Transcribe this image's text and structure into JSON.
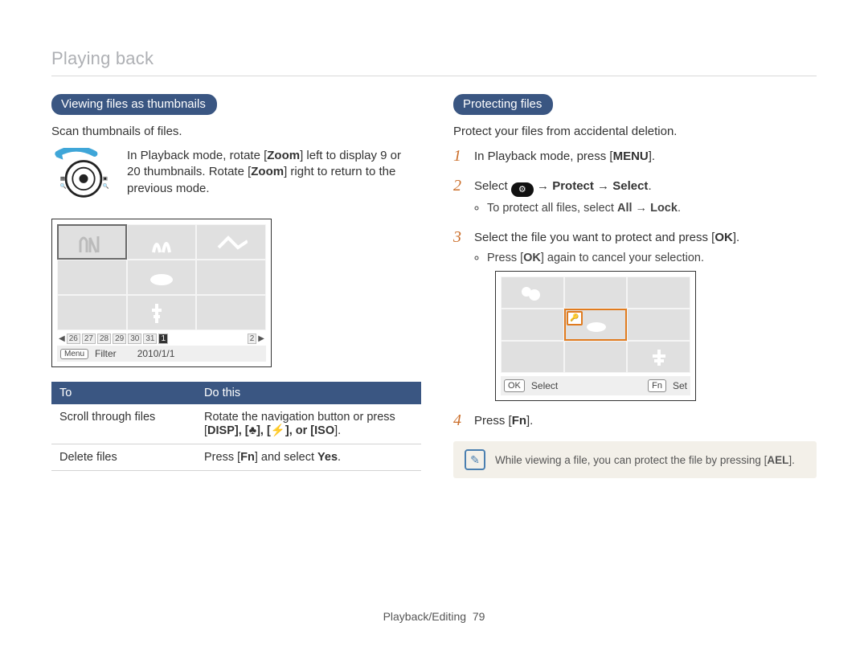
{
  "header": {
    "title": "Playing back"
  },
  "left": {
    "section_title": "Viewing files as thumbnails",
    "lead": "Scan thumbnails of files.",
    "zoom_instruction": {
      "prefix": "In Playback mode, rotate [",
      "zoom1": "Zoom",
      "mid1": "] left to display 9 or 20 thumbnails. Rotate [",
      "zoom2": "Zoom",
      "suffix": "] right to return to the previous mode."
    },
    "screen": {
      "timeline_days": [
        "26",
        "27",
        "28",
        "29",
        "30",
        "31",
        "1",
        "2"
      ],
      "footer_menu_btn": "Menu",
      "footer_filter": "Filter",
      "footer_date": "2010/1/1"
    },
    "table": {
      "head_to": "To",
      "head_do": "Do this",
      "rows": [
        {
          "to": "Scroll through files",
          "do_prefix": "Rotate the navigation button or press [",
          "btns": "DISP], [♣], [⚡], or [ISO",
          "do_suffix": "]."
        },
        {
          "to": "Delete files",
          "do_prefix": "Press [",
          "btns": "Fn",
          "do_suffix": "] and select ",
          "yes": "Yes",
          "tail": "."
        }
      ]
    }
  },
  "right": {
    "section_title": "Protecting files",
    "lead": "Protect your files from accidental deletion.",
    "steps": {
      "s1": {
        "prefix": "In Playback mode, press [",
        "btn": "MENU",
        "suffix": "]."
      },
      "s2": {
        "prefix": "Select ",
        "mid": " → ",
        "protect": "Protect",
        "arrow2": " → ",
        "select": "Select",
        "tail": ".",
        "bullet_prefix": "To protect all files, select ",
        "all": "All",
        "arrow3": " → ",
        "lock": "Lock",
        "bullet_tail": "."
      },
      "s3": {
        "prefix": "Select the file you want to protect and press [",
        "btn": "OK",
        "suffix": "].",
        "bullet_prefix": "Press [",
        "bullet_btn": "OK",
        "bullet_suffix": "] again to cancel your selection."
      },
      "s4": {
        "prefix": "Press [",
        "btn": "Fn",
        "suffix": "]."
      }
    },
    "screen": {
      "ok_btn": "OK",
      "select_label": "Select",
      "fn_btn": "Fn",
      "set_label": "Set"
    },
    "note": {
      "prefix": "While viewing a file, you can protect the file by pressing [",
      "btn": "AEL",
      "suffix": "]."
    }
  },
  "footer": {
    "section": "Playback/Editing",
    "page": "79"
  }
}
